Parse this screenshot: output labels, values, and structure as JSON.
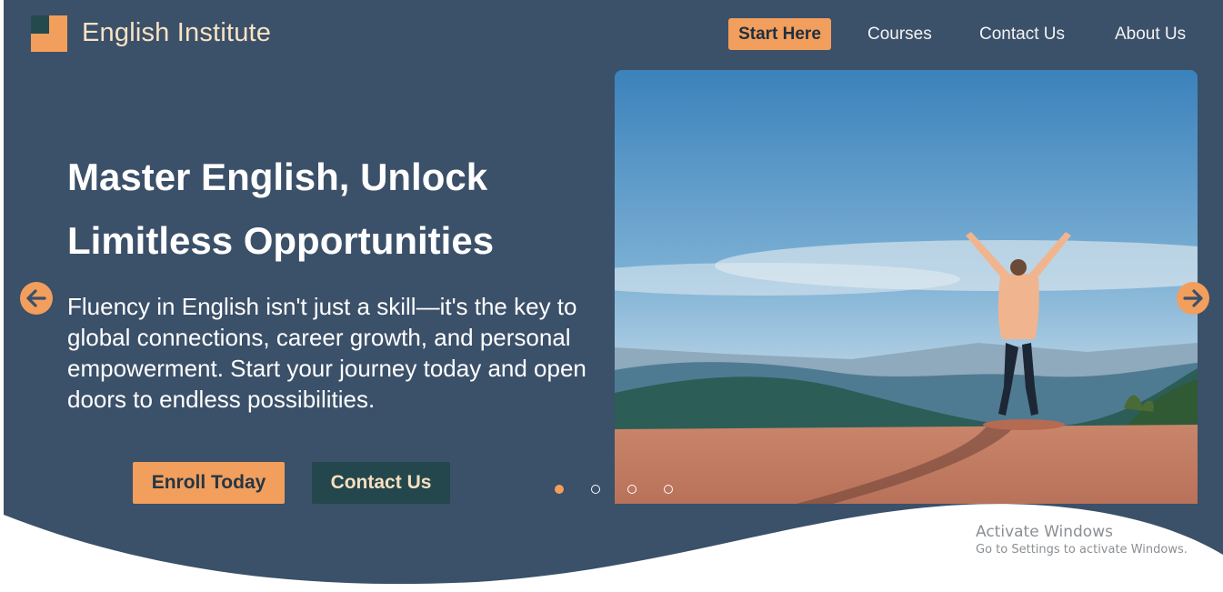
{
  "brand": {
    "name": "English Institute",
    "colors": {
      "dark_square": "#254a4d",
      "orange_square": "#f29e5c"
    }
  },
  "nav": {
    "items": [
      {
        "label": "Start Here",
        "active": true
      },
      {
        "label": "Courses"
      },
      {
        "label": "Contact Us"
      },
      {
        "label": "About Us"
      }
    ]
  },
  "hero": {
    "headline": "Master English, Unlock Limitless Opportunities",
    "subtext": "Fluency in English isn't just a skill—it's the key to global connections, career growth, and personal empowerment. Start your journey today and open doors to endless possibilities.",
    "buttons": {
      "enroll": "Enroll Today",
      "contact": "Contact Us"
    },
    "image": {
      "subject": "person-on-mountain-arms-raised"
    }
  },
  "carousel": {
    "prev_icon": "arrow-left-icon",
    "next_icon": "arrow-right-icon",
    "slide_count": 4,
    "active_index": 0
  },
  "watermark": {
    "title": "Activate Windows",
    "subtitle": "Go to Settings to activate Windows."
  },
  "theme": {
    "background": "#3b5069",
    "accent": "#f29e5c",
    "dark_teal": "#23474c",
    "page": "#ffffff"
  }
}
